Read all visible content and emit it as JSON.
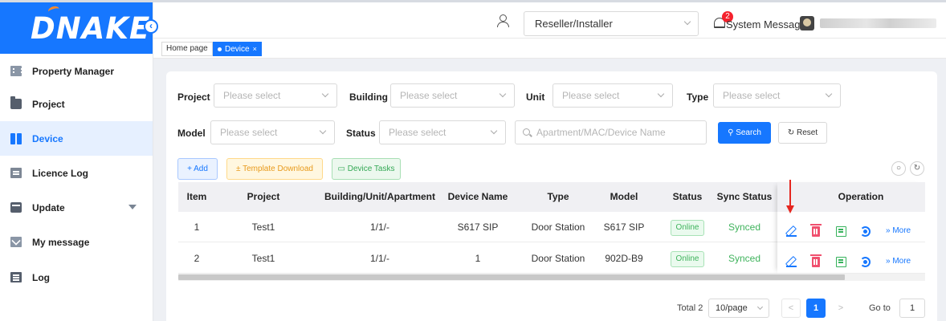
{
  "brand": {
    "logo_text": "DNAKE",
    "color": "#1677ff",
    "accent": "#ff8a2a"
  },
  "sidebar": {
    "collapse_icon": "chevron-left-icon",
    "items": [
      {
        "label": "Property Manager",
        "icon": "building-icon",
        "active": false
      },
      {
        "label": "Project",
        "icon": "folder-icon",
        "active": false
      },
      {
        "label": "Device",
        "icon": "device-icon",
        "active": true
      },
      {
        "label": "Licence Log",
        "icon": "licence-icon",
        "active": false
      },
      {
        "label": "Update",
        "icon": "update-icon",
        "active": false,
        "expandable": true
      },
      {
        "label": "My message",
        "icon": "mail-icon",
        "active": false
      },
      {
        "label": "Log",
        "icon": "log-icon",
        "active": false
      }
    ]
  },
  "header": {
    "role": "Reseller/Installer",
    "notification_count": "2",
    "system_message_label": "System Message"
  },
  "tabs": {
    "home": "Home page",
    "device": "Device",
    "close": "×"
  },
  "filters": {
    "project_label": "Project",
    "building_label": "Building",
    "unit_label": "Unit",
    "type_label": "Type",
    "model_label": "Model",
    "status_label": "Status",
    "select_placeholder": "Please select",
    "search_placeholder": "Apartment/MAC/Device Name",
    "search_button": "Search",
    "reset_button": "Reset"
  },
  "toolbar": {
    "add": "+ Add",
    "template_download": "± Template Download",
    "device_tasks": "Device Tasks"
  },
  "table": {
    "columns": [
      "Item",
      "Project",
      "Building/Unit/Apartment",
      "Device Name",
      "Type",
      "Model",
      "Status",
      "Sync Status",
      "Operation"
    ],
    "rows": [
      {
        "item": "1",
        "project": "Test1",
        "location": "1/1/-",
        "device_name": "S617 SIP",
        "type": "Door Station",
        "model": "S617 SIP",
        "status": "Online",
        "sync": "Synced",
        "more": "» More"
      },
      {
        "item": "2",
        "project": "Test1",
        "location": "1/1/-",
        "device_name": "1",
        "type": "Door Station",
        "model": "902D-B9",
        "status": "Online",
        "sync": "Synced",
        "more": "» More"
      }
    ]
  },
  "pagination": {
    "total": "Total 2",
    "page_size": "10/page",
    "prev": "<",
    "current": "1",
    "next": ">",
    "goto_label": "Go to",
    "goto_value": "1"
  }
}
